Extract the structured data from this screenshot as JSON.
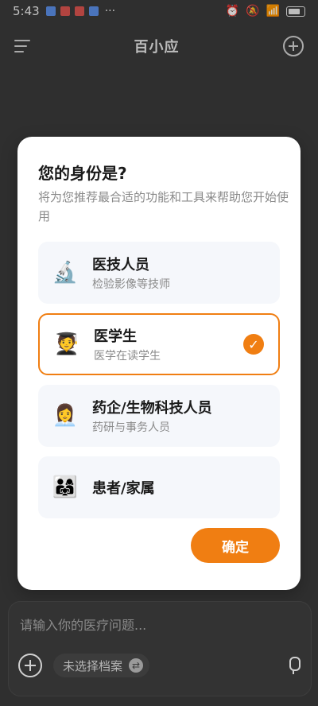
{
  "status": {
    "time": "5:43",
    "icons": [
      "notification-icon",
      "app-icon-1",
      "app-icon-2",
      "app-icon-3"
    ],
    "right_icons": [
      "alarm-icon",
      "mute-icon",
      "wifi-icon",
      "signal-icon",
      "battery-icon"
    ]
  },
  "header": {
    "title": "百小应",
    "left_icon": "menu-icon",
    "right_icon": "new-chat-icon"
  },
  "modal": {
    "title": "您的身份是?",
    "subtitle": "将为您推荐最合适的功能和工具来帮助您开始使用",
    "options": [
      {
        "name": "医技人员",
        "desc": "检验影像等技师",
        "icon": "microscope-icon",
        "emoji": "🔬",
        "selected": false
      },
      {
        "name": "医学生",
        "desc": "医学在读学生",
        "icon": "student-icon",
        "emoji": "🧑‍🎓",
        "selected": true
      },
      {
        "name": "药企/生物科技人员",
        "desc": "药研与事务人员",
        "icon": "pharma-icon",
        "emoji": "👩‍💼",
        "selected": false
      },
      {
        "name": "患者/家属",
        "desc": "",
        "icon": "family-icon",
        "emoji": "👨‍👩‍👧",
        "selected": false
      }
    ],
    "check_mark": "✓",
    "confirm_label": "确定"
  },
  "input": {
    "placeholder": "请输入你的医疗问题...",
    "archive_label": "未选择档案",
    "swap_icon": "⇄"
  },
  "colors": {
    "accent": "#f07e12",
    "background": "#3a3a3a"
  }
}
